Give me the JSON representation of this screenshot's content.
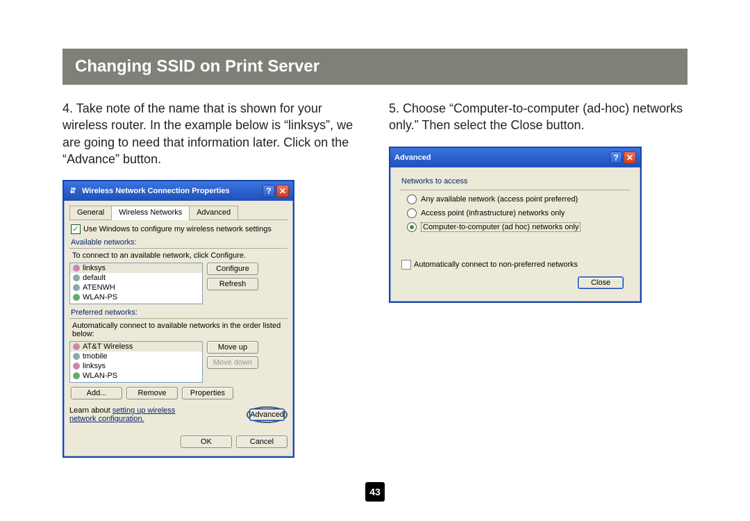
{
  "slide": {
    "title": "Changing SSID on Print Server",
    "page_number": "43"
  },
  "steps": {
    "four": "4. Take note of the name that is shown for your wireless router. In the example below is “linksys”, we are going to need that information later. Click on the “Advance” button.",
    "five": "5. Choose “Computer-to-computer (ad-hoc) networks only.” Then select the Close button."
  },
  "dialog_left": {
    "title": "Wireless Network Connection Properties",
    "tabs": {
      "general": "General",
      "wireless": "Wireless Networks",
      "advanced": "Advanced"
    },
    "use_windows": "Use Windows to configure my wireless network settings",
    "available_label": "Available networks:",
    "available_help": "To connect to an available network, click Configure.",
    "available": [
      "linksys",
      "default",
      "ATENWH",
      "WLAN-PS"
    ],
    "btn_configure": "Configure",
    "btn_refresh": "Refresh",
    "preferred_label": "Preferred networks:",
    "preferred_help": "Automatically connect to available networks in the order listed below:",
    "preferred": [
      "AT&T Wireless",
      "tmobile",
      "linksys",
      "WLAN-PS"
    ],
    "btn_moveup": "Move up",
    "btn_movedown": "Move down",
    "btn_add": "Add...",
    "btn_remove": "Remove",
    "btn_properties": "Properties",
    "learn_text": "Learn about ",
    "learn_link": "setting up wireless network configuration.",
    "btn_advanced": "Advanced",
    "btn_ok": "OK",
    "btn_cancel": "Cancel"
  },
  "dialog_right": {
    "title": "Advanced",
    "group": "Networks to access",
    "opt1": "Any available network (access point preferred)",
    "opt2": "Access point (infrastructure) networks only",
    "opt3": "Computer-to-computer (ad hoc) networks only",
    "auto_connect": "Automatically connect to non-preferred networks",
    "btn_close": "Close"
  }
}
